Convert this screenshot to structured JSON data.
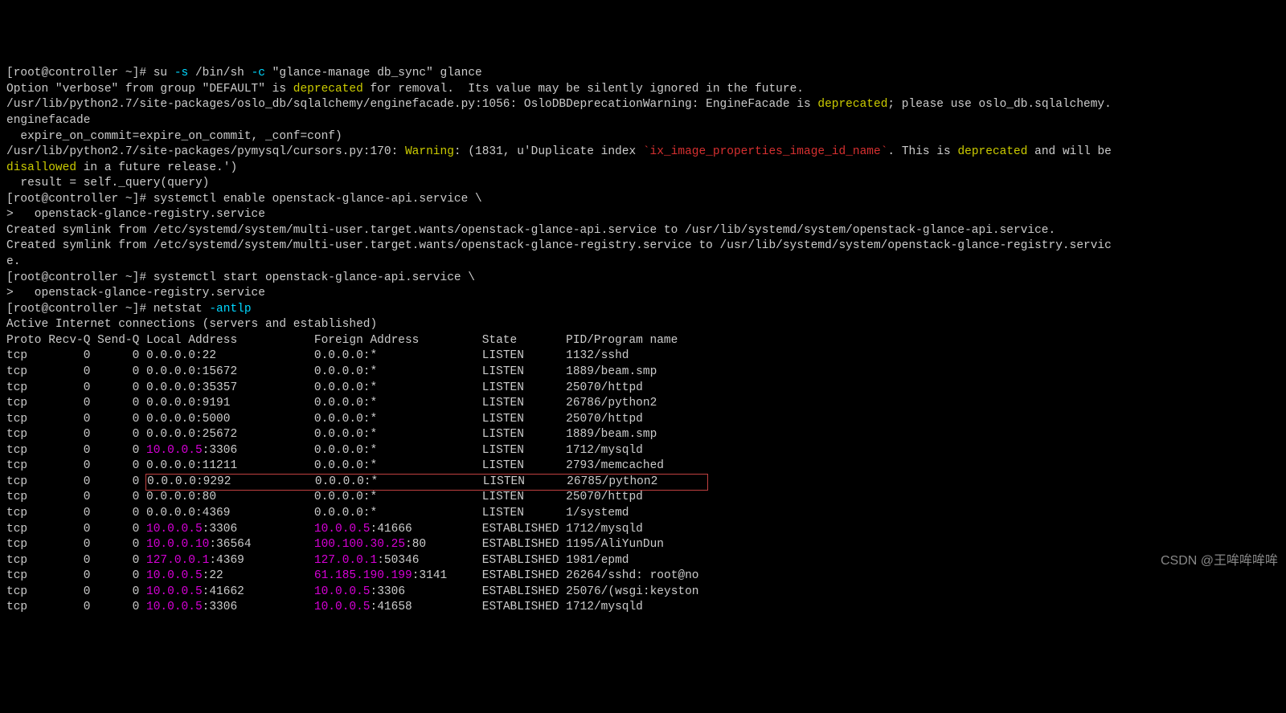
{
  "prompt1": "[root@controller ~]# ",
  "cmd1_a": "su ",
  "cmd1_b": "-s",
  "cmd1_c": " /bin/sh ",
  "cmd1_d": "-c",
  "cmd1_e": " \"glance-manage db_sync\" glance",
  "out1_a": "Option \"verbose\" from group \"DEFAULT\" is ",
  "out1_b": "deprecated",
  "out1_c": " for removal.  Its value may be silently ignored in the future.",
  "out2_a": "/usr/lib/python2.7/site-packages/oslo_db/sqlalchemy/enginefacade.py:1056: OsloDBDeprecationWarning: EngineFacade is ",
  "out2_b": "deprecated",
  "out2_c": "; please use oslo_db.sqlalchemy.",
  "out3": "enginefacade",
  "out4": "  expire_on_commit=expire_on_commit, _conf=conf)",
  "out5_a": "/usr/lib/python2.7/site-packages/pymysql/cursors.py:170: ",
  "out5_b": "Warning",
  "out5_c": ": (1831, u'Duplicate index ",
  "out5_d": "`ix_image_properties_image_id_name`",
  "out5_e": ". This is ",
  "out5_f": "deprecated",
  "out5_g": " and will be ",
  "out6_a": "disallowed",
  "out6_b": " in a future release.')",
  "out7": "  result = self._query(query)",
  "prompt2": "[root@controller ~]# ",
  "cmd2": "systemctl enable openstack-glance-api.service \\",
  "cont1": ">   openstack-glance-registry.service",
  "out8": "Created symlink from /etc/systemd/system/multi-user.target.wants/openstack-glance-api.service to /usr/lib/systemd/system/openstack-glance-api.service.",
  "out9": "Created symlink from /etc/systemd/system/multi-user.target.wants/openstack-glance-registry.service to /usr/lib/systemd/system/openstack-glance-registry.servic",
  "out9b": "e.",
  "prompt3": "[root@controller ~]# ",
  "cmd3": "systemctl start openstack-glance-api.service \\",
  "cont2": ">   openstack-glance-registry.service",
  "prompt4": "[root@controller ~]# ",
  "cmd4_a": "netstat ",
  "cmd4_b": "-antlp",
  "ns_title": "Active Internet connections (servers and established)",
  "hdr": "Proto Recv-Q Send-Q Local Address           Foreign Address         State       PID/Program name    ",
  "rows": [
    {
      "pre": "tcp        0      0 ",
      "la": "0.0.0.0:22",
      "lp": "",
      "pad1": "              ",
      "fa": "0.0.0.0:*",
      "fp": "",
      "pad2": "               ",
      "state": "LISTEN      ",
      "prog": "1132/sshd           "
    },
    {
      "pre": "tcp        0      0 ",
      "la": "0.0.0.0:15672",
      "lp": "",
      "pad1": "           ",
      "fa": "0.0.0.0:*",
      "fp": "",
      "pad2": "               ",
      "state": "LISTEN      ",
      "prog": "1889/beam.smp       "
    },
    {
      "pre": "tcp        0      0 ",
      "la": "0.0.0.0:35357",
      "lp": "",
      "pad1": "           ",
      "fa": "0.0.0.0:*",
      "fp": "",
      "pad2": "               ",
      "state": "LISTEN      ",
      "prog": "25070/httpd         "
    },
    {
      "pre": "tcp        0      0 ",
      "la": "0.0.0.0:9191",
      "lp": "",
      "pad1": "            ",
      "fa": "0.0.0.0:*",
      "fp": "",
      "pad2": "               ",
      "state": "LISTEN      ",
      "prog": "26786/python2       "
    },
    {
      "pre": "tcp        0      0 ",
      "la": "0.0.0.0:5000",
      "lp": "",
      "pad1": "            ",
      "fa": "0.0.0.0:*",
      "fp": "",
      "pad2": "               ",
      "state": "LISTEN      ",
      "prog": "25070/httpd         "
    },
    {
      "pre": "tcp        0      0 ",
      "la": "0.0.0.0:25672",
      "lp": "",
      "pad1": "           ",
      "fa": "0.0.0.0:*",
      "fp": "",
      "pad2": "               ",
      "state": "LISTEN      ",
      "prog": "1889/beam.smp       "
    },
    {
      "pre": "tcp        0      0 ",
      "la": "10.0.0.5",
      "la_c": "magenta",
      "lp": ":3306",
      "pad1": "           ",
      "fa": "0.0.0.0:*",
      "fp": "",
      "pad2": "               ",
      "state": "LISTEN      ",
      "prog": "1712/mysqld         "
    },
    {
      "pre": "tcp        0      0 ",
      "la": "0.0.0.0:11211",
      "lp": "",
      "pad1": "           ",
      "fa": "0.0.0.0:*",
      "fp": "",
      "pad2": "               ",
      "state": "LISTEN      ",
      "prog": "2793/memcached      "
    },
    {
      "pre": "tcp        0      0 ",
      "la": "0.0.0.0:9292",
      "lp": "",
      "pad1": "            ",
      "fa": "0.0.0.0:*",
      "fp": "",
      "pad2": "               ",
      "state": "LISTEN      ",
      "prog": "26785/python2       ",
      "hl": true
    },
    {
      "pre": "tcp        0      0 ",
      "la": "0.0.0.0:80",
      "lp": "",
      "pad1": "              ",
      "fa": "0.0.0.0:*",
      "fp": "",
      "pad2": "               ",
      "state": "LISTEN      ",
      "prog": "25070/httpd         "
    },
    {
      "pre": "tcp        0      0 ",
      "la": "0.0.0.0:4369",
      "lp": "",
      "pad1": "            ",
      "fa": "0.0.0.0:*",
      "fp": "",
      "pad2": "               ",
      "state": "LISTEN      ",
      "prog": "1/systemd           "
    },
    {
      "pre": "tcp        0      0 ",
      "la": "10.0.0.5",
      "la_c": "magenta",
      "lp": ":3306",
      "pad1": "           ",
      "fa": "10.0.0.5",
      "fa_c": "magenta",
      "fp": ":41666",
      "pad2": "          ",
      "state": "ESTABLISHED ",
      "prog": "1712/mysqld         "
    },
    {
      "pre": "tcp        0      0 ",
      "la": "10.0.0.10",
      "la_c": "magenta",
      "lp": ":36564",
      "pad1": "         ",
      "fa": "100.100.30.25",
      "fa_c": "magenta",
      "fp": ":80",
      "pad2": "        ",
      "state": "ESTABLISHED ",
      "prog": "1195/AliYunDun      "
    },
    {
      "pre": "tcp        0      0 ",
      "la": "127.0.0.1",
      "la_c": "magenta",
      "lp": ":4369",
      "pad1": "          ",
      "fa": "127.0.0.1",
      "fa_c": "magenta",
      "fp": ":50346",
      "pad2": "         ",
      "state": "ESTABLISHED ",
      "prog": "1981/epmd           "
    },
    {
      "pre": "tcp        0      0 ",
      "la": "10.0.0.5",
      "la_c": "magenta",
      "lp": ":22",
      "pad1": "             ",
      "fa": "61.185.190.199",
      "fa_c": "magenta",
      "fp": ":3141",
      "pad2": "     ",
      "state": "ESTABLISHED ",
      "prog": "26264/sshd: root@no "
    },
    {
      "pre": "tcp        0      0 ",
      "la": "10.0.0.5",
      "la_c": "magenta",
      "lp": ":41662",
      "pad1": "          ",
      "fa": "10.0.0.5",
      "fa_c": "magenta",
      "fp": ":3306",
      "pad2": "           ",
      "state": "ESTABLISHED ",
      "prog": "25076/(wsgi:keyston "
    },
    {
      "pre": "tcp        0      0 ",
      "la": "10.0.0.5",
      "la_c": "magenta",
      "lp": ":3306",
      "pad1": "           ",
      "fa": "10.0.0.5",
      "fa_c": "magenta",
      "fp": ":41658",
      "pad2": "          ",
      "state": "ESTABLISHED ",
      "prog": "1712/mysqld         "
    }
  ],
  "watermark": "CSDN @王哞哞哞哞"
}
